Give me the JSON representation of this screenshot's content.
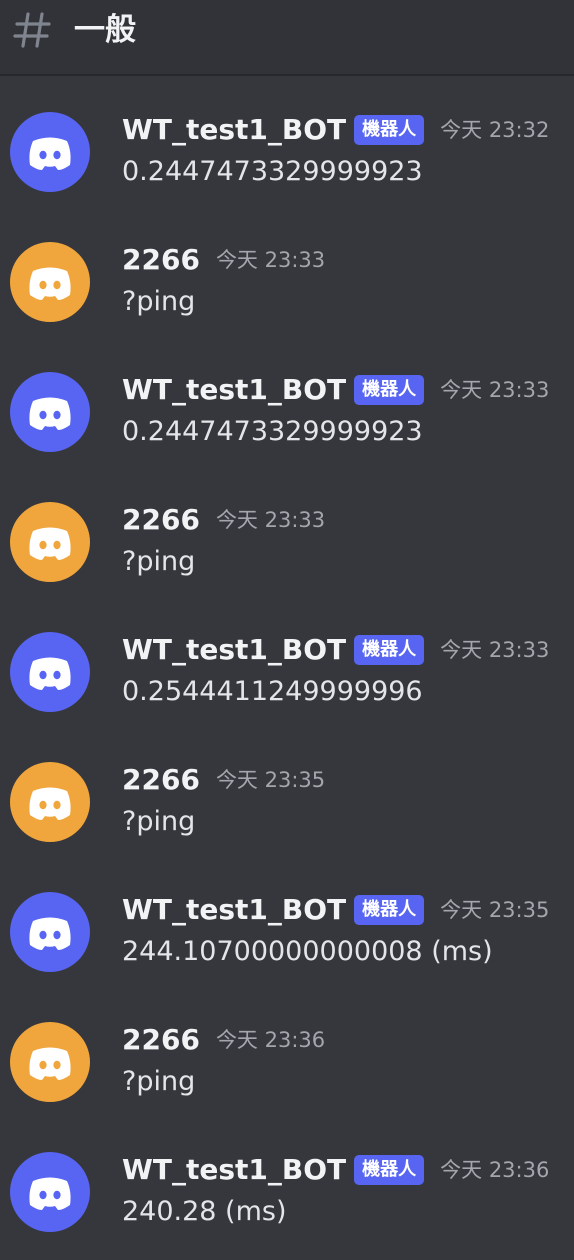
{
  "channel": {
    "name": "一般",
    "icon": "hash-icon"
  },
  "colors": {
    "background": "#36373d",
    "bot_avatar": "#5865f2",
    "user_avatar": "#f0a63c",
    "bot_tag": "#5865f2"
  },
  "messages": [
    {
      "author": "WT_test1_BOT",
      "tag": "機器人",
      "time": "今天 23:32",
      "text": "0.2447473329999923",
      "avatar": "discord-logo-icon"
    },
    {
      "author": "2266",
      "tag": "",
      "time": "今天 23:33",
      "text": "?ping",
      "avatar": "discord-logo-icon"
    },
    {
      "author": "WT_test1_BOT",
      "tag": "機器人",
      "time": "今天 23:33",
      "text": "0.2447473329999923",
      "avatar": "discord-logo-icon"
    },
    {
      "author": "2266",
      "tag": "",
      "time": "今天 23:33",
      "text": "?ping",
      "avatar": "discord-logo-icon"
    },
    {
      "author": "WT_test1_BOT",
      "tag": "機器人",
      "time": "今天 23:33",
      "text": "0.2544411249999996",
      "avatar": "discord-logo-icon"
    },
    {
      "author": "2266",
      "tag": "",
      "time": "今天 23:35",
      "text": "?ping",
      "avatar": "discord-logo-icon"
    },
    {
      "author": "WT_test1_BOT",
      "tag": "機器人",
      "time": "今天 23:35",
      "text": "244.10700000000008 (ms)",
      "avatar": "discord-logo-icon"
    },
    {
      "author": "2266",
      "tag": "",
      "time": "今天 23:36",
      "text": "?ping",
      "avatar": "discord-logo-icon"
    },
    {
      "author": "WT_test1_BOT",
      "tag": "機器人",
      "time": "今天 23:36",
      "text": "240.28 (ms)",
      "avatar": "discord-logo-icon"
    }
  ]
}
